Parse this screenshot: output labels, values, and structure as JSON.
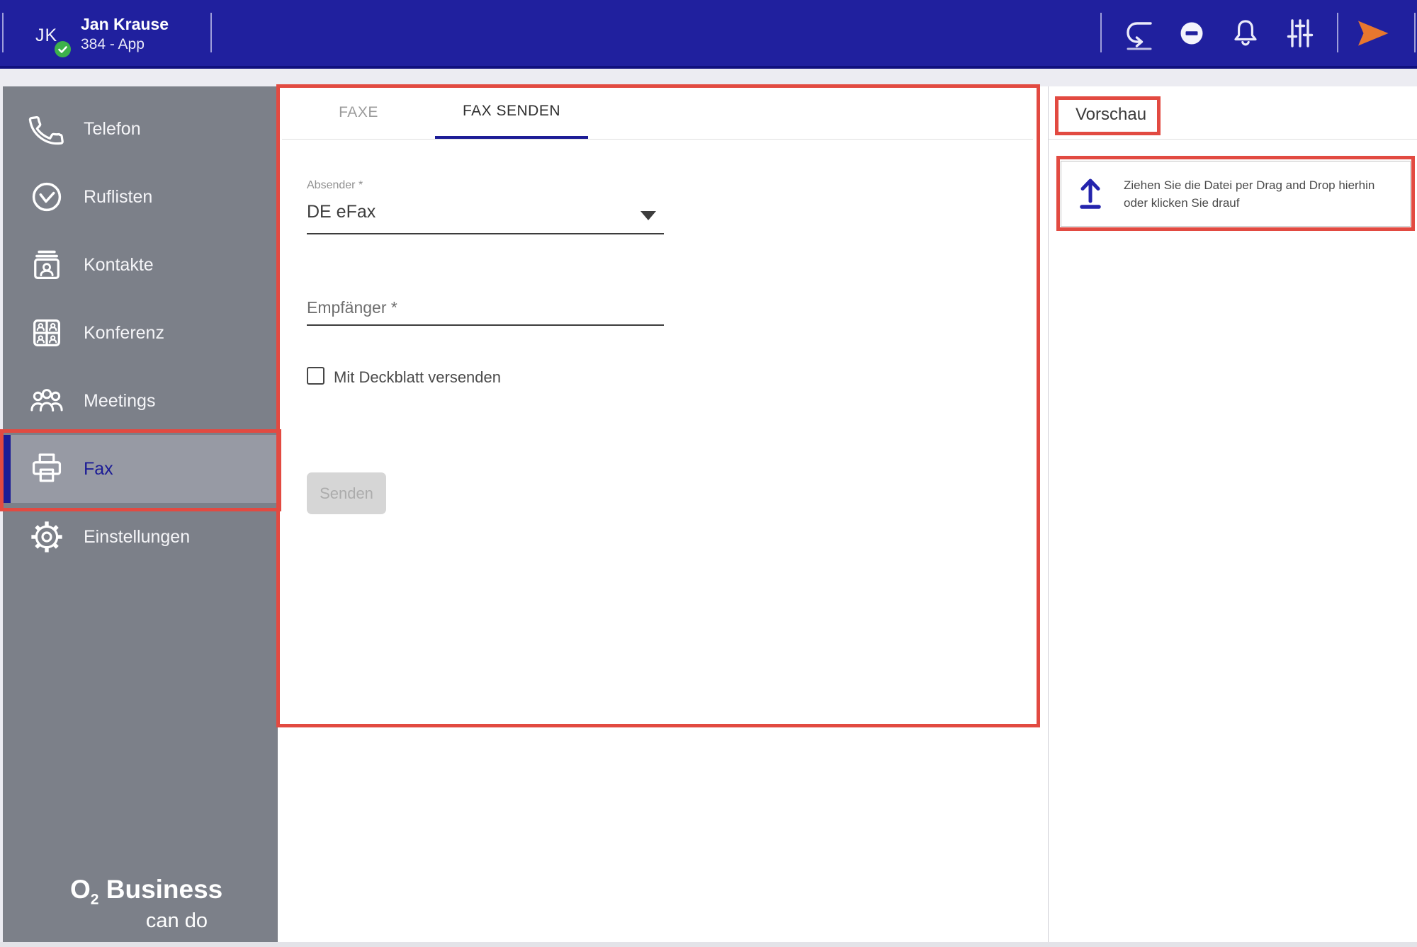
{
  "topbar": {
    "user_initials": "JK",
    "user_name": "Jan Krause",
    "user_subtitle": "384 - App",
    "presence_status": "available",
    "icons": [
      "call-pull-icon",
      "do-not-disturb-icon",
      "notifications-icon",
      "audio-settings-icon",
      "send-icon"
    ]
  },
  "sidebar": {
    "items": [
      {
        "label": "Telefon",
        "icon": "phone-icon",
        "selected": false
      },
      {
        "label": "Ruflisten",
        "icon": "call-history-icon",
        "selected": false
      },
      {
        "label": "Kontakte",
        "icon": "contacts-icon",
        "selected": false
      },
      {
        "label": "Konferenz",
        "icon": "conference-icon",
        "selected": false
      },
      {
        "label": "Meetings",
        "icon": "meetings-icon",
        "selected": false
      },
      {
        "label": "Fax",
        "icon": "fax-icon",
        "selected": true
      },
      {
        "label": "Einstellungen",
        "icon": "settings-icon",
        "selected": false
      }
    ],
    "logo": {
      "brand": "O",
      "brand_sub": "2",
      "brand_rest": " Business",
      "tagline": "can do"
    }
  },
  "main": {
    "tabs": [
      {
        "label": "FAXE",
        "active": false
      },
      {
        "label": "FAX SENDEN",
        "active": true
      }
    ],
    "form": {
      "sender_label": "Absender *",
      "sender_value": "DE eFax",
      "recipient_label": "Empfänger *",
      "cover_label": "Mit Deckblatt versenden",
      "cover_checked": false,
      "send_label": "Senden",
      "send_enabled": false
    }
  },
  "preview": {
    "title": "Vorschau",
    "dropzone_icon": "upload-icon",
    "dropzone_line1": "Ziehen Sie die Datei per Drag and Drop hierhin",
    "dropzone_line2": "oder klicken Sie drauf"
  },
  "annotations": {
    "color": "#e24a41",
    "boxes": [
      "fax-nav-item",
      "fax-send-panel",
      "preview-title",
      "dropzone"
    ]
  },
  "colors": {
    "topbar_blue": "#20209e",
    "accent_blue": "#1c1c96",
    "annotation_red": "#e24a41",
    "presence_green": "#3db14b",
    "send_orange": "#e8772e",
    "sidebar_gray": "#7c8089",
    "selected_item_gray": "#979aa4"
  }
}
